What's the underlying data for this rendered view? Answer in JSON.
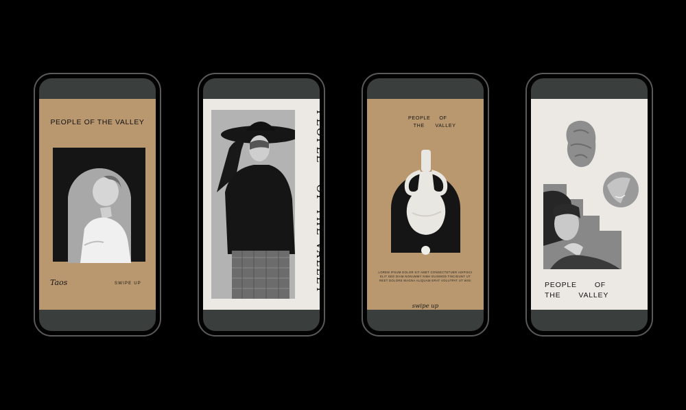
{
  "phones": [
    {
      "title": "PEOPLE OF THE VALLEY",
      "footer_left": "Taos",
      "footer_right": "SWIPE UP"
    },
    {
      "vertical_title": "PEOPLE    OF THE VALLEY"
    },
    {
      "title": "PEOPLE     OF\n   THE      VALLEY",
      "body": "LOREM IPSUM DOLOR SIT AMET CONSECTETUER ADIPISCI ELIT SED DIAM NONUMMY NIBH EUISMOD TINCIDUNT UT REET DOLORE MAGNA ALIQUAM ERAT VOLUTPAT UT WISI",
      "footer": "swipe up"
    },
    {
      "title": "PEOPLE       OF\nTHE       VALLEY"
    }
  ],
  "colors": {
    "background": "#000000",
    "phone_bezel": "#5a5a5a",
    "tan": "#b9986f",
    "off_white": "#ece9e4"
  }
}
